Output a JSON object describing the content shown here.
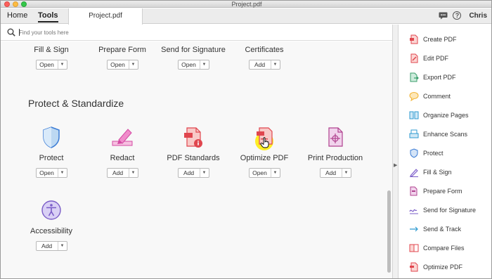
{
  "window": {
    "title": "Project.pdf"
  },
  "tabs": {
    "home": "Home",
    "tools": "Tools",
    "document": "Project.pdf"
  },
  "user": {
    "name": "Chris"
  },
  "search": {
    "placeholder": "Find your tools here"
  },
  "tools_top": [
    {
      "label": "Fill & Sign",
      "action": "Open"
    },
    {
      "label": "Prepare Form",
      "action": "Open"
    },
    {
      "label": "Send for Signature",
      "action": "Open"
    },
    {
      "label": "Certificates",
      "action": "Add"
    }
  ],
  "section": {
    "title": "Protect & Standardize"
  },
  "tools_protect": [
    {
      "label": "Protect",
      "action": "Open",
      "icon": "shield-icon"
    },
    {
      "label": "Redact",
      "action": "Add",
      "icon": "redact-icon"
    },
    {
      "label": "PDF Standards",
      "action": "Add",
      "icon": "pdf-standards-icon"
    },
    {
      "label": "Optimize PDF",
      "action": "Open",
      "icon": "optimize-pdf-icon"
    },
    {
      "label": "Print Production",
      "action": "Add",
      "icon": "print-production-icon"
    },
    {
      "label": "Accessibility",
      "action": "Add",
      "icon": "accessibility-icon"
    }
  ],
  "sidebar": {
    "items": [
      {
        "label": "Create PDF",
        "icon": "create-pdf-icon",
        "color": "#e0464e"
      },
      {
        "label": "Edit PDF",
        "icon": "edit-pdf-icon",
        "color": "#e0464e"
      },
      {
        "label": "Export PDF",
        "icon": "export-pdf-icon",
        "color": "#3a9e6b"
      },
      {
        "label": "Comment",
        "icon": "comment-icon",
        "color": "#f2b230"
      },
      {
        "label": "Organize Pages",
        "icon": "organize-pages-icon",
        "color": "#2e9ad0"
      },
      {
        "label": "Enhance Scans",
        "icon": "enhance-scans-icon",
        "color": "#2e9ad0"
      },
      {
        "label": "Protect",
        "icon": "shield-icon",
        "color": "#3a7bd5"
      },
      {
        "label": "Fill & Sign",
        "icon": "fill-sign-icon",
        "color": "#7a5cc7"
      },
      {
        "label": "Prepare Form",
        "icon": "prepare-form-icon",
        "color": "#b0428f"
      },
      {
        "label": "Send for Signature",
        "icon": "send-signature-icon",
        "color": "#7a5cc7"
      },
      {
        "label": "Send & Track",
        "icon": "send-track-icon",
        "color": "#2e9ad0"
      },
      {
        "label": "Compare Files",
        "icon": "compare-files-icon",
        "color": "#e0464e"
      },
      {
        "label": "Optimize PDF",
        "icon": "optimize-pdf-icon",
        "color": "#e0464e"
      }
    ]
  },
  "colors": {
    "accent": "#2e9ad0",
    "cursor_highlight": "#ffeb00"
  }
}
